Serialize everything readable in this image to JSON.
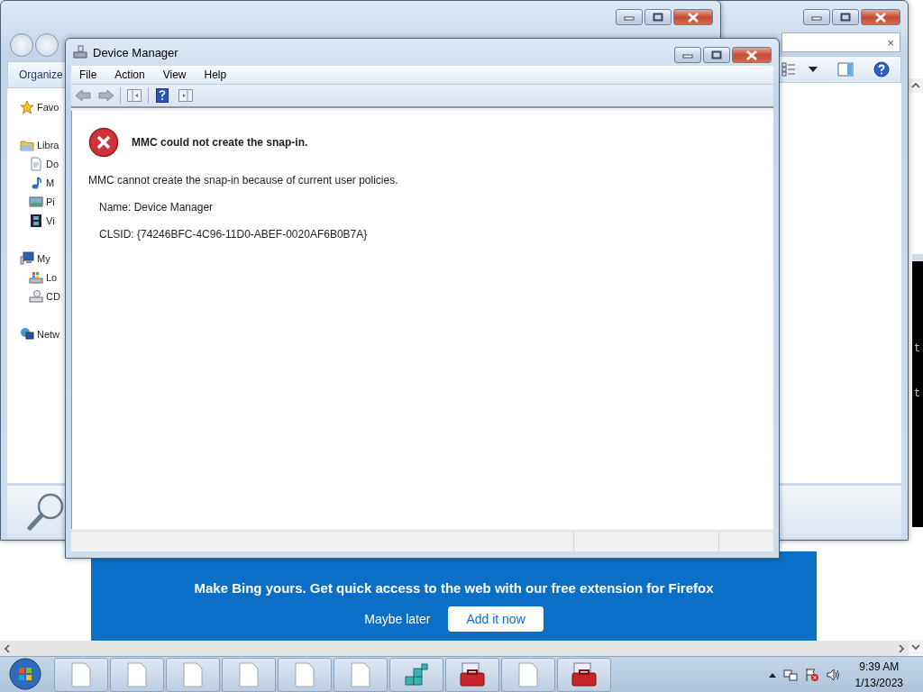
{
  "browser_page": {
    "banner": {
      "headline": "**Make Bing yours.** Get quick access to the web with our free extension for Firefox",
      "dismiss": "Maybe later",
      "action": "Add it now"
    }
  },
  "console": {
    "lines": [
      "t",
      "t"
    ]
  },
  "explorer_back": {
    "search": {
      "clear": "×"
    }
  },
  "explorer_front": {
    "toolbar": {
      "organize": "Organize"
    },
    "sidebar": [
      {
        "label": "Favo",
        "kind": "star"
      },
      {
        "label": "Libra",
        "kind": "library",
        "children": [
          {
            "label": "Do",
            "kind": "documents"
          },
          {
            "label": "M",
            "kind": "music"
          },
          {
            "label": "Pi",
            "kind": "pictures"
          },
          {
            "label": "Vi",
            "kind": "videos"
          }
        ]
      },
      {
        "label": "My",
        "kind": "computer",
        "children": [
          {
            "label": "Lo",
            "kind": "drive"
          },
          {
            "label": "CD",
            "kind": "disc"
          }
        ]
      },
      {
        "label": "Netw",
        "kind": "network"
      }
    ]
  },
  "dialog": {
    "title": "Device Manager",
    "menu": [
      "File",
      "Action",
      "View",
      "Help"
    ],
    "error": {
      "title": "MMC could not create the snap-in.",
      "message": "MMC cannot create the snap-in because of current user policies.",
      "details": [
        "Name: Device Manager",
        "CLSID: {74246BFC-4C96-11D0-ABEF-0020AF6B0B7A}"
      ]
    }
  },
  "taskbar": {
    "buttons": [
      {
        "kind": "document"
      },
      {
        "kind": "document"
      },
      {
        "kind": "document"
      },
      {
        "kind": "document"
      },
      {
        "kind": "document"
      },
      {
        "kind": "document"
      },
      {
        "kind": "registry"
      },
      {
        "kind": "toolbox"
      },
      {
        "kind": "document"
      },
      {
        "kind": "toolbox"
      }
    ],
    "clock": {
      "time": "9:39 AM",
      "date": "1/13/2023"
    }
  }
}
